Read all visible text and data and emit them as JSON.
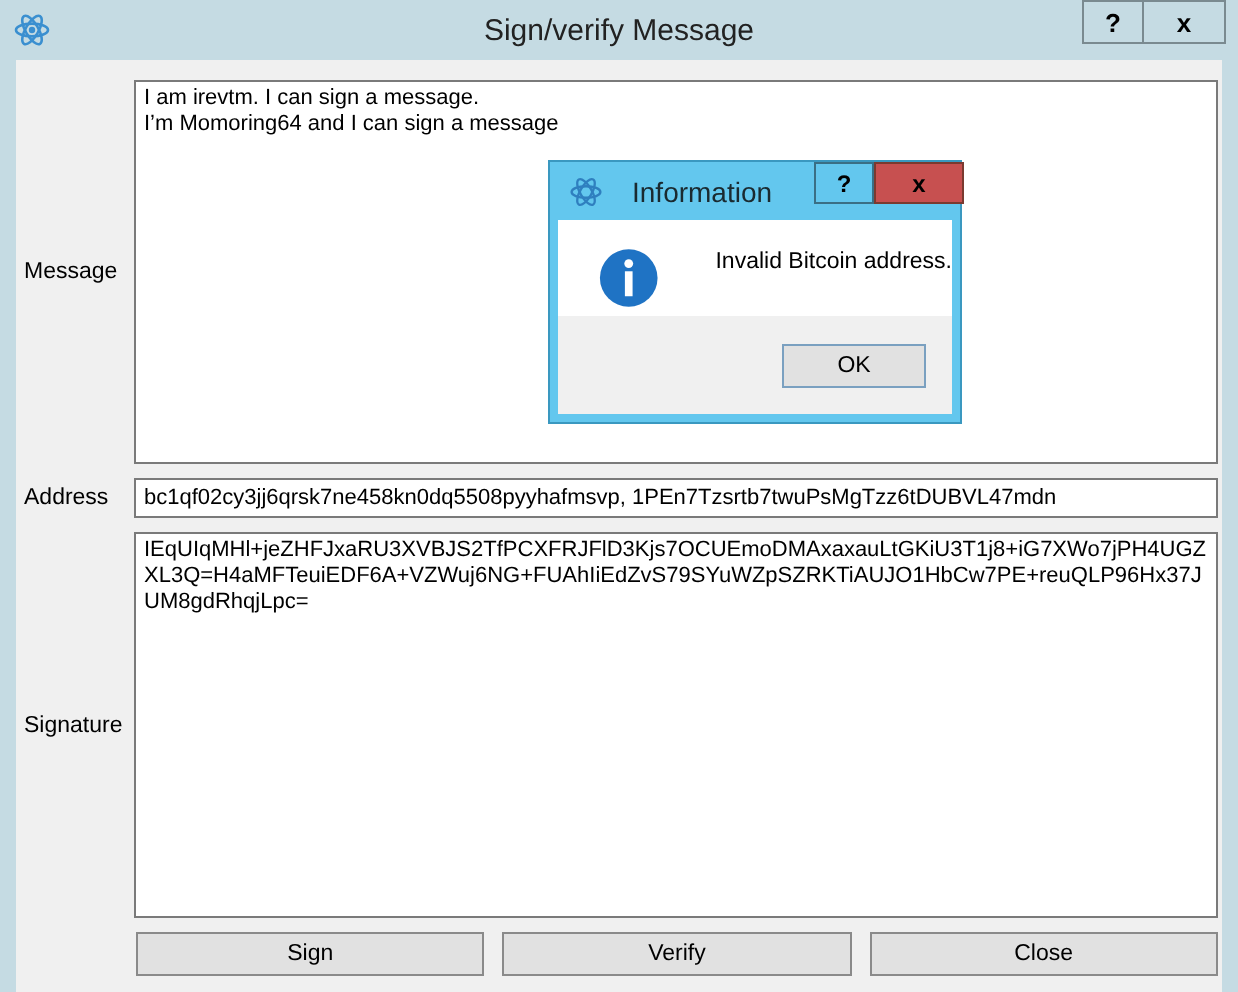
{
  "window": {
    "title": "Sign/verify Message",
    "buttons": [
      "?",
      "x"
    ]
  },
  "fields": [
    {
      "label": "Message",
      "kind": "multiline",
      "value": "I am irevtm. I can sign a message.\nI’m Momoring64 and I can sign a message"
    },
    {
      "label": "Address",
      "kind": "line",
      "value": "bc1qf02cy3jj6qrsk7ne458kn0dq5508pyyhafmsvp, 1PEn7Tzsrtb7twuPsMgTzz6tDUBVL47mdn"
    },
    {
      "label": "Signature",
      "kind": "multiline",
      "value": "IEqUIqMHl+jeZHFJxaRU3XVBJS2TfPCXFRJFlD3Kjs7OCUEmoDMAxaxauLtGKiU3T1j8+iG7XWo7jPH4UGZXL3Q=H4aMFTeuiEDF6A+VZWuj6NG+FUAhIiEdZvS79SYuWZpSZRKTiAUJO1HbCw7PE+reuQLP96Hx37JUM8gdRhqjLpc="
    }
  ],
  "buttons": [
    "Sign",
    "Verify",
    "Close"
  ],
  "dialog": {
    "title": "Information",
    "buttons": [
      "?",
      "x"
    ],
    "message": "Invalid Bitcoin address.",
    "ok": "OK"
  }
}
